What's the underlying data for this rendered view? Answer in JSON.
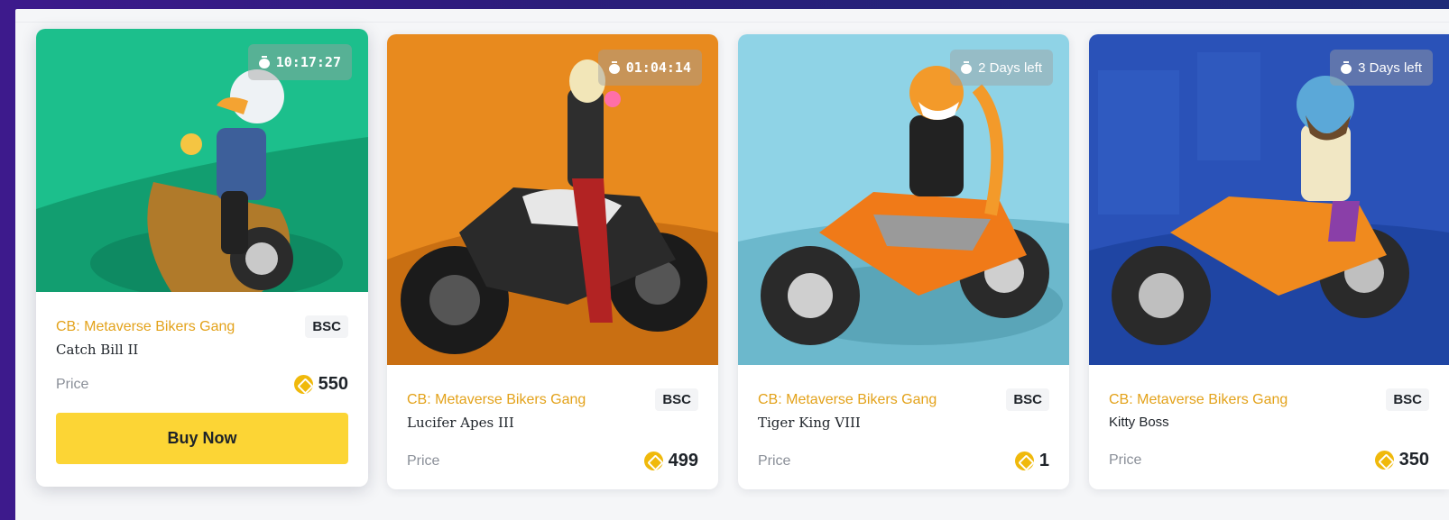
{
  "cards": [
    {
      "timer": "10:17:27",
      "collection": "CB: Metaverse Bikers Gang",
      "chain": "BSC",
      "name": "Catch Bill II",
      "price_label": "Price",
      "price": "550",
      "buy_label": "Buy Now",
      "art_bg": "#1fbf8f"
    },
    {
      "timer": "01:04:14",
      "collection": "CB: Metaverse Bikers Gang",
      "chain": "BSC",
      "name": "Lucifer Apes III",
      "price_label": "Price",
      "price": "499",
      "art_bg": "#e88a1e"
    },
    {
      "timer": "2 Days left",
      "collection": "CB: Metaverse Bikers Gang",
      "chain": "BSC",
      "name": "Tiger King VIII",
      "price_label": "Price",
      "price": "1",
      "art_bg": "#8fd3e6"
    },
    {
      "timer": "3 Days left",
      "collection": "CB: Metaverse Bikers Gang",
      "chain": "BSC",
      "name": "Kitty Boss",
      "price_label": "Price",
      "price": "350",
      "art_bg": "#2a52b8"
    }
  ],
  "icons": {
    "timer": "stopwatch-icon",
    "coin": "bnb-coin-icon"
  },
  "colors": {
    "accent": "#fcd535",
    "collection_text": "#e3a21a",
    "coin": "#f0b90b"
  }
}
